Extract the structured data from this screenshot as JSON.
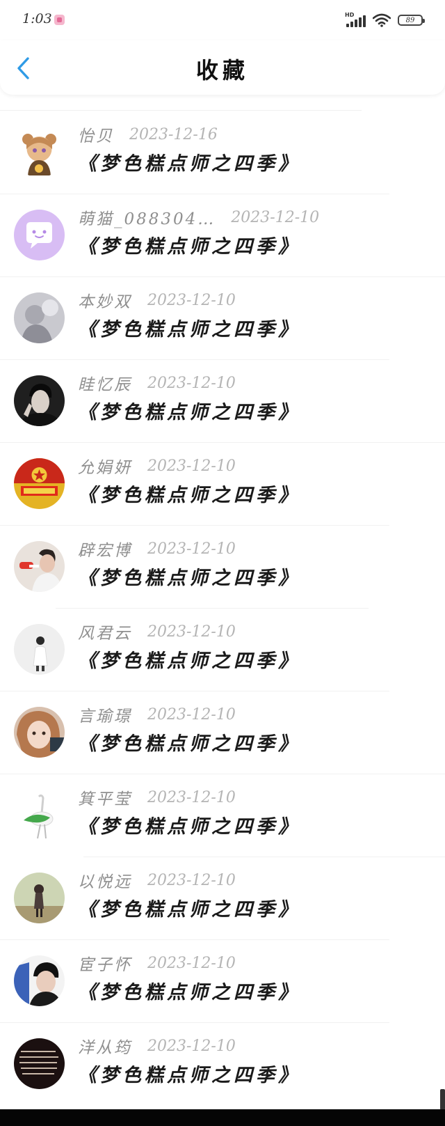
{
  "status_bar": {
    "time": "1:03",
    "network": "HD",
    "battery": "89"
  },
  "header": {
    "title": "收藏"
  },
  "items": [
    {
      "user": "怡贝",
      "date": "2023-12-16",
      "title": "《梦色糕点师之四季》",
      "avatar_color": "#f1e1cf"
    },
    {
      "user": "萌猫_088304…",
      "date": "2023-12-10",
      "title": "《梦色糕点师之四季》",
      "avatar_color": "#d8bdf4"
    },
    {
      "user": "本妙双",
      "date": "2023-12-10",
      "title": "《梦色糕点师之四季》",
      "avatar_color": "#b8b8bf"
    },
    {
      "user": "眭忆辰",
      "date": "2023-12-10",
      "title": "《梦色糕点师之四季》",
      "avatar_color": "#2a2a2a"
    },
    {
      "user": "允娟妍",
      "date": "2023-12-10",
      "title": "《梦色糕点师之四季》",
      "avatar_color": "#d92f1e"
    },
    {
      "user": "辟宏博",
      "date": "2023-12-10",
      "title": "《梦色糕点师之四季》",
      "avatar_color": "#d9cfc7"
    },
    {
      "user": "风君云",
      "date": "2023-12-10",
      "title": "《梦色糕点师之四季》",
      "avatar_color": "#ececec"
    },
    {
      "user": "言瑜璟",
      "date": "2023-12-10",
      "title": "《梦色糕点师之四季》",
      "avatar_color": "#c99a7d"
    },
    {
      "user": "箕平莹",
      "date": "2023-12-10",
      "title": "《梦色糕点师之四季》",
      "avatar_color": "#ffffff"
    },
    {
      "user": "以悦远",
      "date": "2023-12-10",
      "title": "《梦色糕点师之四季》",
      "avatar_color": "#b9c39a"
    },
    {
      "user": "宦子怀",
      "date": "2023-12-10",
      "title": "《梦色糕点师之四季》",
      "avatar_color": "#1e2431"
    },
    {
      "user": "洋从筠",
      "date": "2023-12-10",
      "title": "《梦色糕点师之四季》",
      "avatar_color": "#1b1010"
    }
  ],
  "colors": {
    "back_arrow": "#2f9be6",
    "name_text": "#8f8f8f",
    "date_text": "#b4b4b4",
    "title_text": "#1a1a1a"
  },
  "icons": {
    "back": "chevron-left-icon",
    "signal": "signal-icon",
    "wifi": "wifi-icon",
    "battery": "battery-icon"
  }
}
